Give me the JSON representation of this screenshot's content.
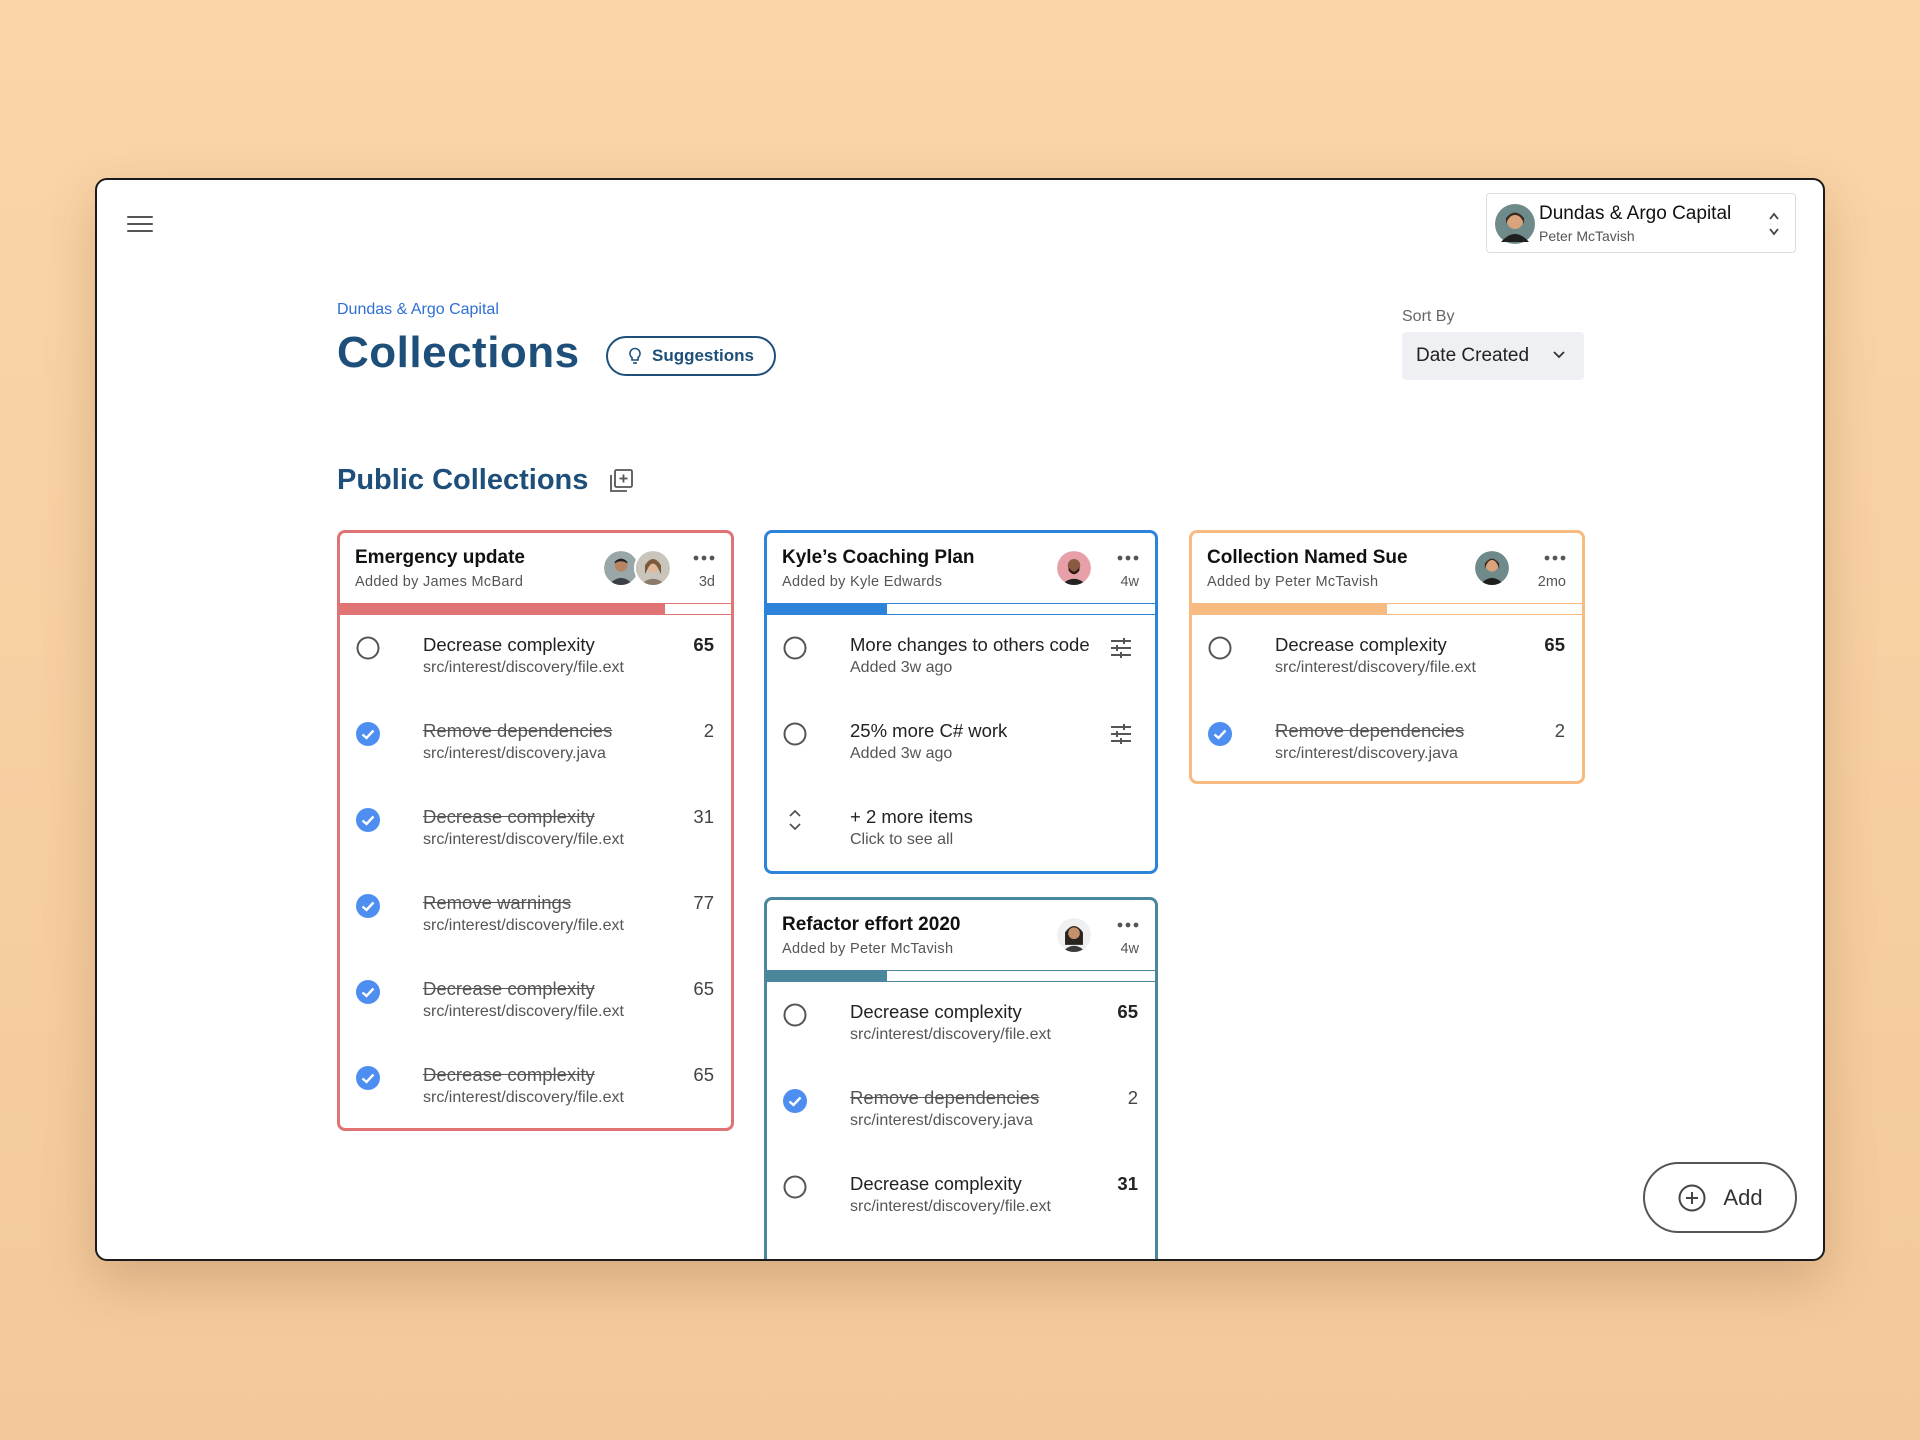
{
  "account": {
    "org": "Dundas & Argo Capital",
    "user": "Peter McTavish"
  },
  "breadcrumb": "Dundas & Argo Capital",
  "page_title": "Collections",
  "suggestions_label": "Suggestions",
  "sort": {
    "label": "Sort By",
    "value": "Date Created"
  },
  "section_title": "Public Collections",
  "add_label": "Add",
  "colors": {
    "red": "#e07474",
    "blue": "#2b84d9",
    "orange": "#f7ba80",
    "teal": "#4a879c",
    "check": "#4e8ef0"
  },
  "cards": [
    {
      "title": "Emergency update",
      "added_by": "Added by James McBard",
      "age": "3d",
      "progress": 0.83,
      "items": [
        {
          "name": "Decrease complexity",
          "path": "src/interest/discovery/file.ext",
          "count": "65",
          "done": false
        },
        {
          "name": "Remove dependencies",
          "path": "src/interest/discovery.java",
          "count": "2",
          "done": true
        },
        {
          "name": "Decrease complexity",
          "path": "src/interest/discovery/file.ext",
          "count": "31",
          "done": true
        },
        {
          "name": "Remove warnings",
          "path": "src/interest/discovery/file.ext",
          "count": "77",
          "done": true
        },
        {
          "name": "Decrease complexity",
          "path": "src/interest/discovery/file.ext",
          "count": "65",
          "done": true
        },
        {
          "name": "Decrease complexity",
          "path": "src/interest/discovery/file.ext",
          "count": "65",
          "done": true
        }
      ]
    },
    {
      "title": "Kyle’s Coaching Plan",
      "added_by": "Added by Kyle Edwards",
      "age": "4w",
      "progress": 0.31,
      "items": [
        {
          "name": "More changes to others code",
          "sub": "Added 3w ago"
        },
        {
          "name": "25% more C# work",
          "sub": "Added 3w ago"
        }
      ],
      "more": {
        "label": "+ 2 more items",
        "sub": "Click to see all"
      }
    },
    {
      "title": "Collection Named Sue",
      "added_by": "Added by Peter McTavish",
      "age": "2mo",
      "progress": 0.5,
      "items": [
        {
          "name": "Decrease complexity",
          "path": "src/interest/discovery/file.ext",
          "count": "65",
          "done": false
        },
        {
          "name": "Remove dependencies",
          "path": "src/interest/discovery.java",
          "count": "2",
          "done": true
        }
      ]
    },
    {
      "title": "Refactor effort 2020",
      "added_by": "Added by Peter McTavish",
      "age": "4w",
      "progress": 0.31,
      "items": [
        {
          "name": "Decrease complexity",
          "path": "src/interest/discovery/file.ext",
          "count": "65",
          "done": false
        },
        {
          "name": "Remove dependencies",
          "path": "src/interest/discovery.java",
          "count": "2",
          "done": true
        },
        {
          "name": "Decrease complexity",
          "path": "src/interest/discovery/file.ext",
          "count": "31",
          "done": false
        }
      ]
    }
  ]
}
